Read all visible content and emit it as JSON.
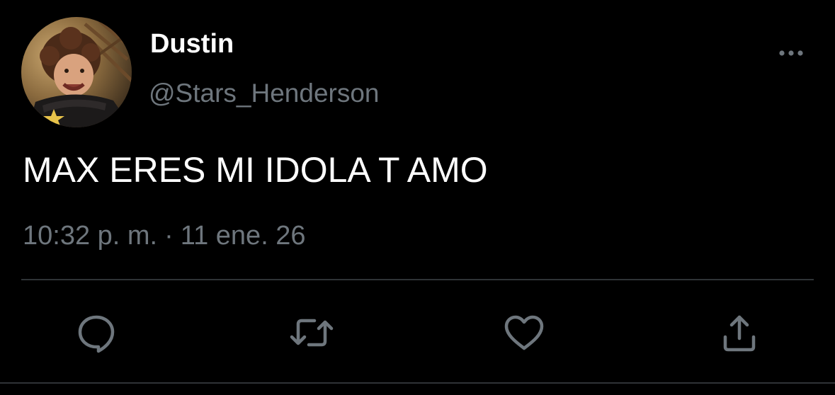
{
  "tweet": {
    "author": {
      "display_name": "Dustin",
      "handle": "@Stars_Henderson",
      "avatar_icon": "profile-photo"
    },
    "text": "MAX ERES MI IDOLA T AMO",
    "time": "10:32 p. m.",
    "separator": "·",
    "date": "11 ene. 26"
  },
  "actions": {
    "reply_icon": "speech-bubble-icon",
    "retweet_icon": "retweet-arrows-icon",
    "like_icon": "heart-icon",
    "share_icon": "share-upload-icon",
    "more_icon": "ellipsis-icon"
  },
  "colors": {
    "background": "#000000",
    "primary_text": "#ffffff",
    "secondary_text": "#6e767d",
    "divider": "#2f3336"
  }
}
